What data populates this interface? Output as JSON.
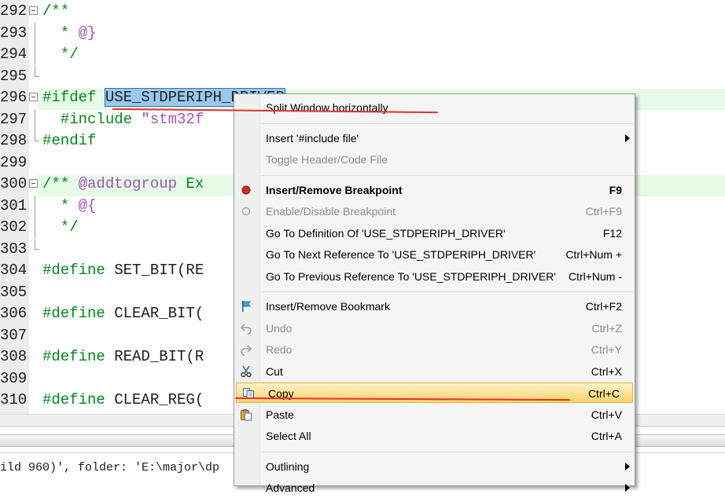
{
  "editor": {
    "lines": [
      {
        "num": "292",
        "fold": "box",
        "parts": [
          {
            "t": "/**",
            "c": "kw-comment"
          }
        ]
      },
      {
        "num": "293",
        "fold": "line",
        "parts": [
          {
            "t": "  * ",
            "c": "kw-comment"
          },
          {
            "t": "@}",
            "c": "doc-tag"
          }
        ]
      },
      {
        "num": "294",
        "fold": "line",
        "parts": [
          {
            "t": "  */",
            "c": "kw-comment"
          }
        ]
      },
      {
        "num": "295",
        "fold": "end",
        "parts": []
      },
      {
        "num": "296",
        "fold": "box",
        "parts": [
          {
            "t": "#ifdef ",
            "c": "kw-green"
          },
          {
            "t": "USE_STDPERIPH_DRIVER",
            "c": "sel"
          }
        ]
      },
      {
        "num": "297",
        "fold": "line",
        "parts": [
          {
            "t": "  #include ",
            "c": "kw-green"
          },
          {
            "t": "\"stm32f",
            "c": "str"
          }
        ]
      },
      {
        "num": "298",
        "fold": "end",
        "parts": [
          {
            "t": "#endif",
            "c": "kw-green"
          }
        ]
      },
      {
        "num": "299",
        "fold": "none",
        "parts": []
      },
      {
        "num": "300",
        "fold": "box",
        "parts": [
          {
            "t": "/** ",
            "c": "kw-comment"
          },
          {
            "t": "@addtogroup",
            "c": "doc-tag"
          },
          {
            "t": " Ex",
            "c": "kw-comment"
          }
        ]
      },
      {
        "num": "301",
        "fold": "line",
        "parts": [
          {
            "t": "  * ",
            "c": "kw-comment"
          },
          {
            "t": "@{",
            "c": "doc-tag"
          }
        ]
      },
      {
        "num": "302",
        "fold": "line",
        "parts": [
          {
            "t": "  */",
            "c": "kw-comment"
          }
        ]
      },
      {
        "num": "303",
        "fold": "end",
        "parts": []
      },
      {
        "num": "304",
        "fold": "none",
        "parts": [
          {
            "t": "#define ",
            "c": "kw-green"
          },
          {
            "t": "SET_BIT(RE",
            "c": "plain"
          }
        ]
      },
      {
        "num": "305",
        "fold": "none",
        "parts": []
      },
      {
        "num": "306",
        "fold": "none",
        "parts": [
          {
            "t": "#define ",
            "c": "kw-green"
          },
          {
            "t": "CLEAR_BIT(",
            "c": "plain"
          }
        ]
      },
      {
        "num": "307",
        "fold": "none",
        "parts": []
      },
      {
        "num": "308",
        "fold": "none",
        "parts": [
          {
            "t": "#define ",
            "c": "kw-green"
          },
          {
            "t": "READ_BIT(R",
            "c": "plain"
          }
        ]
      },
      {
        "num": "309",
        "fold": "none",
        "parts": []
      },
      {
        "num": "310",
        "fold": "none",
        "parts": [
          {
            "t": "#define ",
            "c": "kw-green"
          },
          {
            "t": "CLEAR_REG(",
            "c": "plain"
          }
        ]
      }
    ]
  },
  "output": {
    "text": "ild 960)', folder: 'E:\\major\\dp"
  },
  "menu": {
    "items": [
      {
        "label": "Split Window horizontally",
        "shortcut": "",
        "icon": "",
        "state": "normal",
        "name": "menu-item-split-window"
      },
      {
        "sep": true
      },
      {
        "label": "Insert '#include file'",
        "shortcut": "",
        "icon": "",
        "state": "normal",
        "submenu": true,
        "name": "menu-item-insert-include"
      },
      {
        "label": "Toggle Header/Code File",
        "shortcut": "",
        "icon": "",
        "state": "disabled",
        "name": "menu-item-toggle-header"
      },
      {
        "sep": true
      },
      {
        "label": "Insert/Remove Breakpoint",
        "shortcut": "F9",
        "icon": "breakpoint-icon",
        "state": "bold",
        "name": "menu-item-insert-breakpoint"
      },
      {
        "label": "Enable/Disable Breakpoint",
        "shortcut": "Ctrl+F9",
        "icon": "breakpoint-disabled-icon",
        "state": "disabled",
        "name": "menu-item-enable-breakpoint"
      },
      {
        "label": "Go To Definition Of 'USE_STDPERIPH_DRIVER'",
        "shortcut": "F12",
        "icon": "",
        "state": "normal",
        "name": "menu-item-goto-definition"
      },
      {
        "label": "Go To Next Reference To 'USE_STDPERIPH_DRIVER'",
        "shortcut": "Ctrl+Num +",
        "icon": "",
        "state": "normal",
        "name": "menu-item-next-reference"
      },
      {
        "label": "Go To Previous Reference To 'USE_STDPERIPH_DRIVER'",
        "shortcut": "Ctrl+Num -",
        "icon": "",
        "state": "normal",
        "name": "menu-item-previous-reference"
      },
      {
        "sep": true
      },
      {
        "label": "Insert/Remove Bookmark",
        "shortcut": "Ctrl+F2",
        "icon": "bookmark-flag-icon",
        "state": "normal",
        "name": "menu-item-bookmark"
      },
      {
        "label": "Undo",
        "shortcut": "Ctrl+Z",
        "icon": "undo-icon",
        "state": "disabled",
        "name": "menu-item-undo"
      },
      {
        "label": "Redo",
        "shortcut": "Ctrl+Y",
        "icon": "redo-icon",
        "state": "disabled",
        "name": "menu-item-redo"
      },
      {
        "label": "Cut",
        "shortcut": "Ctrl+X",
        "icon": "scissors-icon",
        "state": "normal",
        "name": "menu-item-cut"
      },
      {
        "label": "Copy",
        "shortcut": "Ctrl+C",
        "icon": "copy-icon",
        "state": "hover",
        "name": "menu-item-copy"
      },
      {
        "label": "Paste",
        "shortcut": "Ctrl+V",
        "icon": "paste-icon",
        "state": "normal",
        "name": "menu-item-paste"
      },
      {
        "label": "Select All",
        "shortcut": "Ctrl+A",
        "icon": "",
        "state": "normal",
        "name": "menu-item-select-all"
      },
      {
        "sep": true
      },
      {
        "label": "Outlining",
        "shortcut": "",
        "icon": "",
        "state": "normal",
        "submenu": true,
        "name": "menu-item-outlining"
      },
      {
        "label": "Advanced",
        "shortcut": "",
        "icon": "",
        "state": "normal",
        "submenu": true,
        "name": "menu-item-advanced"
      }
    ]
  },
  "colors": {
    "keyword": "#00891c",
    "string": "#a451b8",
    "selection": "#99c9ef",
    "annotation": "#e5302b",
    "hover": "#fcd36b"
  }
}
